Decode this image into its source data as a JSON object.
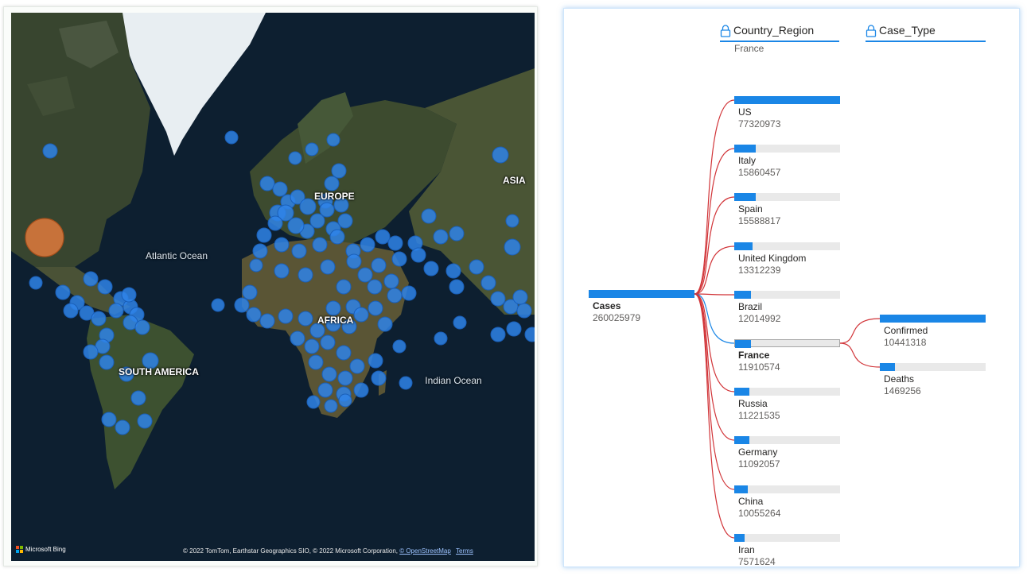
{
  "map": {
    "labels": {
      "europe": "EUROPE",
      "asia": "ASIA",
      "africa": "AFRICA",
      "south_america": "SOUTH AMERICA"
    },
    "oceans": {
      "atlantic": "Atlantic Ocean",
      "indian": "Indian Ocean"
    },
    "logo_text": "Microsoft Bing",
    "attribution": "© 2022 TomTom, Earthstar Geographics SIO, © 2022 Microsoft Corporation,",
    "osm_link": "© OpenStreetMap",
    "terms_link": "Terms",
    "colors": {
      "bubble": "#2f84e8",
      "highlight_bubble": "#e07a3c",
      "land": "#3a4a2e",
      "ice": "#e8eef2",
      "ocean": "#0d1f30"
    }
  },
  "tree": {
    "headers": {
      "level1": "Country_Region",
      "level2": "Case_Type"
    },
    "filter_value": "France",
    "root": {
      "label": "Cases",
      "value": "260025979"
    },
    "countries": [
      {
        "label": "US",
        "value": "77320973",
        "fraction": 1.0
      },
      {
        "label": "Italy",
        "value": "15860457",
        "fraction": 0.205
      },
      {
        "label": "Spain",
        "value": "15588817",
        "fraction": 0.202
      },
      {
        "label": "United Kingdom",
        "value": "13312239",
        "fraction": 0.172
      },
      {
        "label": "Brazil",
        "value": "12014992",
        "fraction": 0.155
      },
      {
        "label": "France",
        "value": "11910574",
        "fraction": 0.154,
        "selected": true
      },
      {
        "label": "Russia",
        "value": "11221535",
        "fraction": 0.145
      },
      {
        "label": "Germany",
        "value": "11092057",
        "fraction": 0.143
      },
      {
        "label": "China",
        "value": "10055264",
        "fraction": 0.13
      },
      {
        "label": "Iran",
        "value": "7571624",
        "fraction": 0.098
      }
    ],
    "case_types": [
      {
        "label": "Confirmed",
        "value": "10441318",
        "fraction": 1.0
      },
      {
        "label": "Deaths",
        "value": "1469256",
        "fraction": 0.141
      }
    ],
    "colors": {
      "bar": "#1a86e6",
      "track": "#e9e9e9",
      "connector": "#d13438",
      "selected_connector": "#1a86e6"
    }
  }
}
